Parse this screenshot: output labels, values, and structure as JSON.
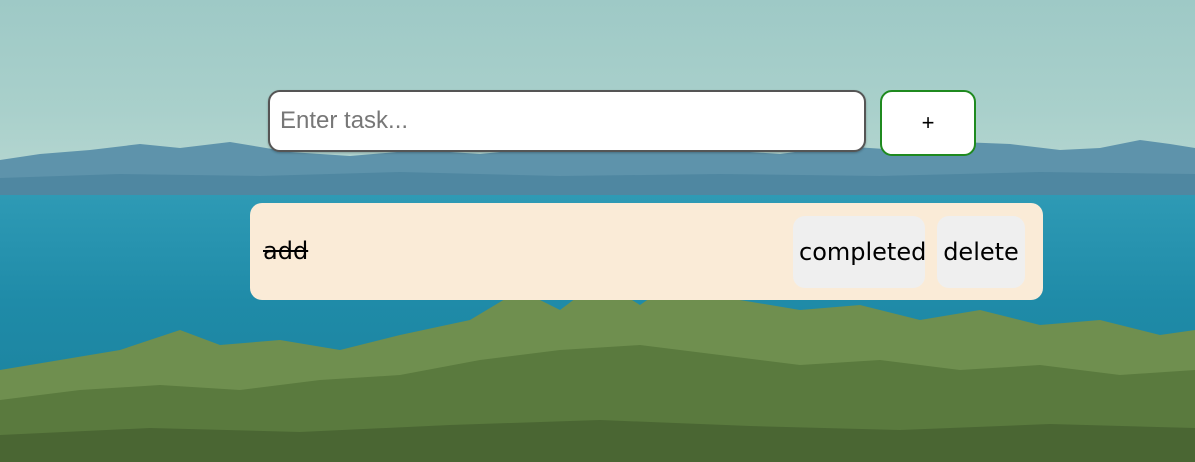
{
  "new_task": {
    "placeholder": "Enter task...",
    "value": "",
    "add_label": "+"
  },
  "tasks": [
    {
      "text": "add",
      "completed": true,
      "completed_label": "completed",
      "delete_label": "delete"
    }
  ],
  "colors": {
    "card_background": "#faebd7",
    "button_background": "#efefef",
    "add_button_border": "#1f8a1f",
    "input_border": "#555555"
  }
}
